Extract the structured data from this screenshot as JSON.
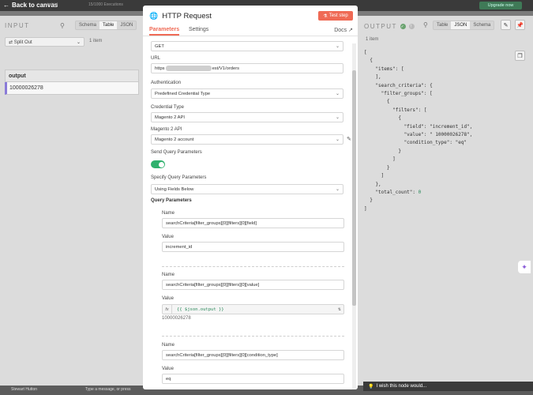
{
  "topbar": {
    "back_label": "Back to canvas",
    "faded_1": "in trial",
    "faded_2": "15/1000 Executions",
    "upgrade": "Upgrade now"
  },
  "input_panel": {
    "title": "INPUT",
    "tabs": [
      "Schema",
      "Table",
      "JSON"
    ],
    "active_tab": "Table",
    "node_select": "Split Out",
    "item_count": "1 item",
    "table_header": "output",
    "table_rows": [
      "10000026278"
    ]
  },
  "modal": {
    "title": "HTTP Request",
    "test_button": "Test step",
    "tabs": [
      "Parameters",
      "Settings"
    ],
    "docs": "Docs",
    "method": "GET",
    "url_label": "URL",
    "url_prefix": "https",
    "url_suffix": "est/V1/orders",
    "auth_label": "Authentication",
    "auth_value": "Predefined Credential Type",
    "cred_type_label": "Credential Type",
    "cred_type_value": "Magento 2 API",
    "cred_label": "Magento 2 API",
    "cred_value": "Magento 2 account",
    "send_query_label": "Send Query Parameters",
    "specify_label": "Specify Query Parameters",
    "specify_value": "Using Fields Below",
    "query_params_label": "Query Parameters",
    "params": [
      {
        "name_label": "Name",
        "name": "searchCriteria[filter_groups][0][filters][0][field]",
        "value_label": "Value",
        "value": "increment_id"
      },
      {
        "name_label": "Name",
        "name": "searchCriteria[filter_groups][0][filters][0][value]",
        "value_label": "Value",
        "value": "{{ $json.output }}",
        "preview": "10000026278"
      },
      {
        "name_label": "Name",
        "name": "searchCriteria[filter_groups][0][filters][0][condition_type]",
        "value_label": "Value",
        "value": "eq"
      }
    ]
  },
  "output_panel": {
    "title": "OUTPUT",
    "tabs": [
      "Table",
      "JSON",
      "Schema"
    ],
    "active_tab": "JSON",
    "item_count": "1 item",
    "json_lines": {
      "l1": "[",
      "l2": "  {",
      "l3k": "    \"items\": [",
      "l4": "    ],",
      "l5k": "    \"search_criteria\": {",
      "l6k": "      \"filter_groups\": [",
      "l7": "        {",
      "l8k": "          \"filters\": [",
      "l9": "            {",
      "l10k": "              \"field\": ",
      "l10v": "\"increment_id\",",
      "l11k": "              \"value\": ",
      "l11v": "\" 10000026278\",",
      "l12k": "              \"condition_type\": ",
      "l12v": "\"eq\"",
      "l13": "            }",
      "l14": "          ]",
      "l15": "        }",
      "l16": "      ]",
      "l17": "    },",
      "l18k": "    \"total_count\": ",
      "l18v": "0",
      "l19": "  }",
      "l20": "]"
    }
  },
  "bottom": {
    "user": "Stewart Hutton",
    "placeholder": "Type a message, or press",
    "wish": "I wish this node would..."
  }
}
